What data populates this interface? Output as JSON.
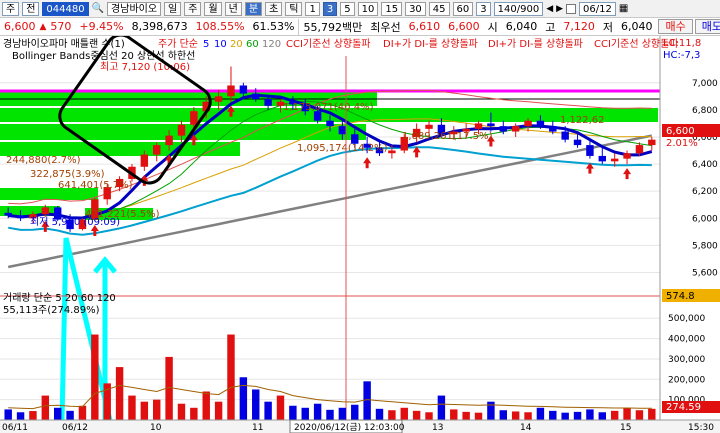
{
  "toolbar": {
    "market_select": "주",
    "exchange_select": "전",
    "stock_code": "044480",
    "stock_name": "경남바이오",
    "period_buttons": [
      "일",
      "주",
      "월",
      "년",
      "분",
      "초",
      "틱"
    ],
    "minute_buttons": [
      "1",
      "3",
      "5",
      "10",
      "15",
      "30",
      "45",
      "60"
    ],
    "active_minute": "3",
    "extra_select": "3",
    "count": "140/900",
    "date": "06/12"
  },
  "quote": {
    "price": "6,600",
    "change_arrow": "▲",
    "change": "570",
    "change_pct": "+9.45%",
    "volume": "8,398,673",
    "vol_ratio": "108.55%",
    "turnover": "61.53%",
    "amount": "55,792백만",
    "best_label": "최우선",
    "best_ask": "6,610",
    "best_bid": "6,600",
    "open_label": "시",
    "open": "6,040",
    "high_label": "고",
    "high": "7,120",
    "low_label": "저",
    "low": "6,040",
    "buy_btn": "매수",
    "sell_btn": "매도"
  },
  "chart_labels": {
    "price_legend": "경남바이오파마 매틀랜 수(1)",
    "ma_legend": "주가 단순",
    "ma_periods": [
      "5",
      "10",
      "20",
      "60",
      "120"
    ],
    "signals": [
      "CCI기준선 상향돌파",
      "DI+가 DI-를 상향돌파",
      "DI+가 DI-를 상향돌파",
      "CCI기준선 상향돌파"
    ],
    "bollinger": "Bollinger Bands중심선 20 상한선 하한선",
    "high_note": "최고 7,120 (10:06)",
    "low_note": "최저 5,900 (09:09)",
    "band_labels": [
      "1,175,071(40.4%)",
      "1,089,261(17.5%)",
      "1,095,174(14.2%)",
      "244,880(2.7%)",
      "322,875(3.9%)",
      "641,401(5.7%)",
      "471,221(5.5%)",
      "1,122,62"
    ],
    "right_top": [
      "LC:11,8",
      "HC:-7,3"
    ],
    "current_price_tag": "6,600",
    "change_tag": "2.01%",
    "volume_legend": "거래량 단순 5 20 60 120",
    "volume_value": "55,113주(274.89%)",
    "volume_tag": "574.8",
    "volume_tag2": "274.59",
    "crosshair_label": "2020/06/12(금) 12:03:00",
    "time_labels": [
      "06/11",
      "06/12",
      "10",
      "11",
      "13",
      "14",
      "15",
      "15:30"
    ]
  },
  "chart_data": {
    "type": "candlestick",
    "price_axis": [
      "7,000",
      "6,800",
      "6,600",
      "6,400",
      "6,200",
      "6,000",
      "5,800",
      "5,600"
    ],
    "volume_axis": [
      "500,000",
      "400,000",
      "300,000",
      "200,000",
      "100,000"
    ],
    "price_ylim": [
      5500,
      7050
    ],
    "volume_ylim": [
      0,
      570000
    ],
    "candles": [
      [
        6040,
        6080,
        6000,
        6020
      ],
      [
        6020,
        6060,
        5980,
        6000
      ],
      [
        6000,
        6050,
        5960,
        6030
      ],
      [
        6030,
        6100,
        6010,
        6080
      ],
      [
        6080,
        6090,
        5980,
        5990
      ],
      [
        5990,
        6030,
        5900,
        5920
      ],
      [
        5920,
        6000,
        5910,
        5990
      ],
      [
        5990,
        6150,
        5980,
        6140
      ],
      [
        6140,
        6250,
        6100,
        6230
      ],
      [
        6230,
        6310,
        6200,
        6290
      ],
      [
        6290,
        6400,
        6270,
        6380
      ],
      [
        6380,
        6500,
        6350,
        6470
      ],
      [
        6470,
        6560,
        6420,
        6540
      ],
      [
        6540,
        6650,
        6500,
        6610
      ],
      [
        6610,
        6720,
        6560,
        6690
      ],
      [
        6690,
        6820,
        6650,
        6790
      ],
      [
        6790,
        6900,
        6740,
        6860
      ],
      [
        6860,
        6950,
        6800,
        6900
      ],
      [
        6900,
        7120,
        6860,
        6980
      ],
      [
        6980,
        7000,
        6880,
        6920
      ],
      [
        6920,
        6960,
        6860,
        6880
      ],
      [
        6880,
        6900,
        6800,
        6830
      ],
      [
        6830,
        6880,
        6780,
        6860
      ],
      [
        6860,
        6900,
        6800,
        6840
      ],
      [
        6840,
        6880,
        6760,
        6790
      ],
      [
        6790,
        6830,
        6700,
        6720
      ],
      [
        6720,
        6760,
        6640,
        6680
      ],
      [
        6680,
        6720,
        6580,
        6620
      ],
      [
        6620,
        6660,
        6520,
        6550
      ],
      [
        6550,
        6600,
        6480,
        6520
      ],
      [
        6520,
        6580,
        6460,
        6480
      ],
      [
        6480,
        6540,
        6440,
        6500
      ],
      [
        6500,
        6620,
        6480,
        6600
      ],
      [
        6600,
        6700,
        6560,
        6660
      ],
      [
        6660,
        6720,
        6620,
        6690
      ],
      [
        6690,
        6740,
        6600,
        6620
      ],
      [
        6620,
        6680,
        6580,
        6640
      ],
      [
        6640,
        6700,
        6600,
        6660
      ],
      [
        6660,
        6720,
        6620,
        6700
      ],
      [
        6700,
        6780,
        6640,
        6680
      ],
      [
        6680,
        6720,
        6620,
        6640
      ],
      [
        6640,
        6700,
        6600,
        6680
      ],
      [
        6680,
        6740,
        6640,
        6720
      ],
      [
        6720,
        6760,
        6660,
        6680
      ],
      [
        6680,
        6720,
        6620,
        6640
      ],
      [
        6640,
        6680,
        6560,
        6580
      ],
      [
        6580,
        6620,
        6520,
        6540
      ],
      [
        6540,
        6580,
        6440,
        6460
      ],
      [
        6460,
        6520,
        6400,
        6420
      ],
      [
        6420,
        6480,
        6380,
        6440
      ],
      [
        6440,
        6500,
        6400,
        6480
      ],
      [
        6480,
        6560,
        6460,
        6540
      ],
      [
        6540,
        6600,
        6500,
        6580
      ]
    ],
    "volumes": [
      52000,
      38000,
      44000,
      120000,
      60000,
      45000,
      70000,
      420000,
      180000,
      260000,
      120000,
      90000,
      100000,
      310000,
      80000,
      60000,
      140000,
      90000,
      420000,
      210000,
      150000,
      90000,
      120000,
      70000,
      60000,
      80000,
      50000,
      60000,
      75000,
      190000,
      55000,
      48000,
      60000,
      45000,
      38000,
      120000,
      52000,
      40000,
      36000,
      90000,
      48000,
      42000,
      38000,
      60000,
      45000,
      36000,
      40000,
      52000,
      38000,
      45000,
      60000,
      48000,
      55000
    ],
    "vol_ma": [
      60000,
      58000,
      56000,
      70000,
      72000,
      68000,
      66000,
      130000,
      150000,
      170000,
      160000,
      150000,
      140000,
      160000,
      150000,
      140000,
      130000,
      125000,
      160000,
      170000,
      165000,
      150000,
      140000,
      120000,
      110000,
      100000,
      95000,
      90000,
      88000,
      100000,
      95000,
      90000,
      85000,
      80000,
      75000,
      78000,
      76000,
      74000,
      72000,
      74000,
      72000,
      70000,
      68000,
      67000,
      65000,
      63000,
      62000,
      61000,
      60000,
      59000,
      59000,
      58000,
      58000
    ]
  }
}
